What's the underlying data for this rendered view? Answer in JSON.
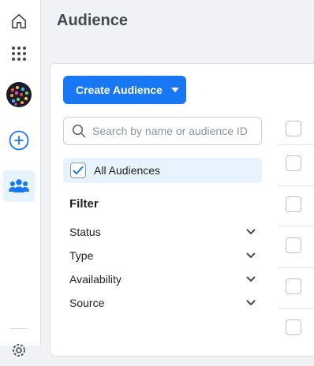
{
  "page": {
    "title": "Audience"
  },
  "rail": {
    "items": [
      {
        "name": "home",
        "icon": "home-icon"
      },
      {
        "name": "apps",
        "icon": "grid-icon"
      },
      {
        "name": "account",
        "icon": "avatar"
      },
      {
        "name": "create",
        "icon": "plus-circle-icon"
      },
      {
        "name": "audiences",
        "icon": "people-icon",
        "active": true
      },
      {
        "name": "settings",
        "icon": "gear-icon"
      }
    ]
  },
  "toolbar": {
    "create_label": "Create Audience"
  },
  "search": {
    "placeholder": "Search by name or audience ID",
    "value": ""
  },
  "audience_filter": {
    "all_label": "All Audiences",
    "all_checked": true
  },
  "filter": {
    "title": "Filter",
    "items": [
      {
        "label": "Status"
      },
      {
        "label": "Type"
      },
      {
        "label": "Availability"
      },
      {
        "label": "Source"
      }
    ]
  },
  "colors": {
    "accent": "#1877f2",
    "selected_bg": "#e7f3ff",
    "page_bg": "#f0f2f5"
  }
}
